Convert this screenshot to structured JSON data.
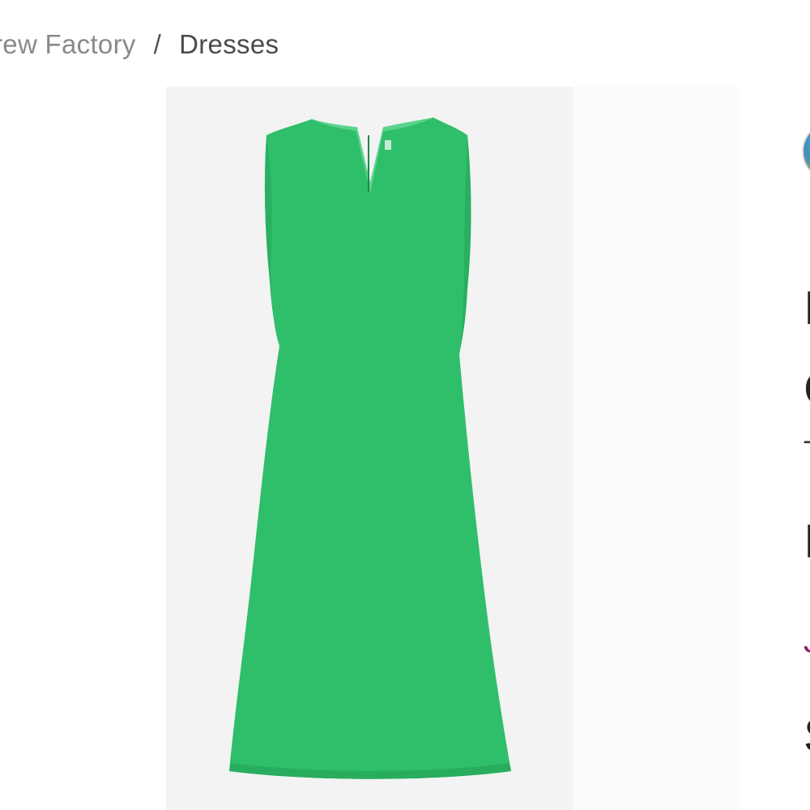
{
  "breadcrumb": {
    "parent": "rew Factory",
    "separator": "/",
    "current": "Dresses"
  },
  "product_image": {
    "alt": "Sleeveless notched-neck shift dress",
    "dress_color": "#2fbf6a",
    "dress_shadow": "#27a85b",
    "background": "#f3f3f3"
  },
  "right_panel": {
    "avatar_icon": "profile-avatar-icon",
    "line1": "I",
    "line2": "C",
    "line3": "T",
    "line4": "I",
    "accent_line": "J",
    "line5": "S",
    "accent_color": "#8a1f6a"
  }
}
